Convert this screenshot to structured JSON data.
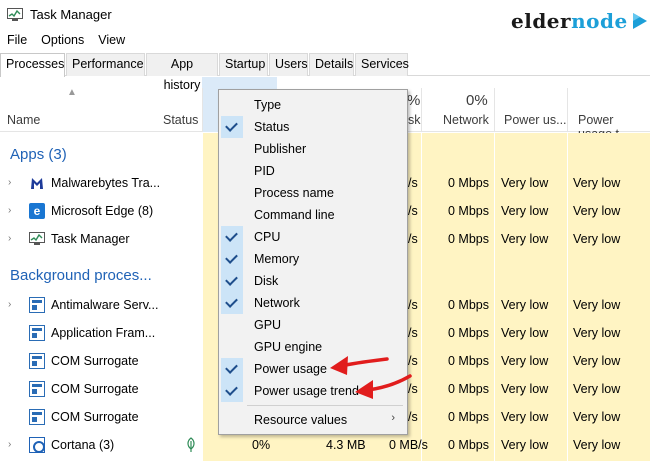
{
  "window": {
    "title": "Task Manager"
  },
  "brand": {
    "part1": "elder",
    "part2": "node"
  },
  "menu": [
    "File",
    "Options",
    "View"
  ],
  "tabs": [
    "Processes",
    "Performance",
    "App history",
    "Startup",
    "Users",
    "Details",
    "Services"
  ],
  "columns": {
    "name": "Name",
    "status": "Status",
    "disk_pct_fragment": "%",
    "disk_label_fragment": "sk",
    "network_pct": "0%",
    "network": "Network",
    "power": "Power us...",
    "power_trend": "Power usage t"
  },
  "groups": {
    "apps": "Apps (3)",
    "background": "Background proces..."
  },
  "rows": [
    {
      "name": "Malwarebytes Tra...",
      "cpu": "",
      "memory": "",
      "disk": "/s",
      "network": "0 Mbps",
      "power": "Very low",
      "trend": "Very low"
    },
    {
      "name": "Microsoft Edge (8)",
      "cpu": "",
      "memory": "",
      "disk": "/s",
      "network": "0 Mbps",
      "power": "Very low",
      "trend": "Very low"
    },
    {
      "name": "Task Manager",
      "cpu": "",
      "memory": "",
      "disk": "/s",
      "network": "0 Mbps",
      "power": "Very low",
      "trend": "Very low"
    },
    {
      "name": "Antimalware Serv...",
      "cpu": "",
      "memory": "",
      "disk": "/s",
      "network": "0 Mbps",
      "power": "Very low",
      "trend": "Very low"
    },
    {
      "name": "Application Fram...",
      "cpu": "",
      "memory": "",
      "disk": "/s",
      "network": "0 Mbps",
      "power": "Very low",
      "trend": "Very low"
    },
    {
      "name": "COM Surrogate",
      "cpu": "",
      "memory": "",
      "disk": "/s",
      "network": "0 Mbps",
      "power": "Very low",
      "trend": "Very low"
    },
    {
      "name": "COM Surrogate",
      "cpu": "",
      "memory": "",
      "disk": "/s",
      "network": "0 Mbps",
      "power": "Very low",
      "trend": "Very low"
    },
    {
      "name": "COM Surrogate",
      "cpu": "",
      "memory": "",
      "disk": "/s",
      "network": "0 Mbps",
      "power": "Very low",
      "trend": "Very low"
    },
    {
      "name": "Cortana (3)",
      "cpu": "0%",
      "memory": "4.3 MB",
      "disk": "0 MB/s",
      "network": "0 Mbps",
      "power": "Very low",
      "trend": "Very low"
    }
  ],
  "context_menu": {
    "items": [
      {
        "label": "Type",
        "checked": false
      },
      {
        "label": "Status",
        "checked": true
      },
      {
        "label": "Publisher",
        "checked": false
      },
      {
        "label": "PID",
        "checked": false
      },
      {
        "label": "Process name",
        "checked": false
      },
      {
        "label": "Command line",
        "checked": false
      },
      {
        "label": "CPU",
        "checked": true
      },
      {
        "label": "Memory",
        "checked": true
      },
      {
        "label": "Disk",
        "checked": true
      },
      {
        "label": "Network",
        "checked": true
      },
      {
        "label": "GPU",
        "checked": false
      },
      {
        "label": "GPU engine",
        "checked": false
      },
      {
        "label": "Power usage",
        "checked": true
      },
      {
        "label": "Power usage trend",
        "checked": true
      }
    ],
    "submenu": {
      "label": "Resource values",
      "arrow": "›"
    }
  },
  "colors": {
    "accent": "#1f62b6",
    "tint": "#fff4c3",
    "check_bg": "#cce4f7",
    "annotation": "#e11d1d"
  },
  "icons": {
    "status_leaf": "leaf-icon"
  }
}
